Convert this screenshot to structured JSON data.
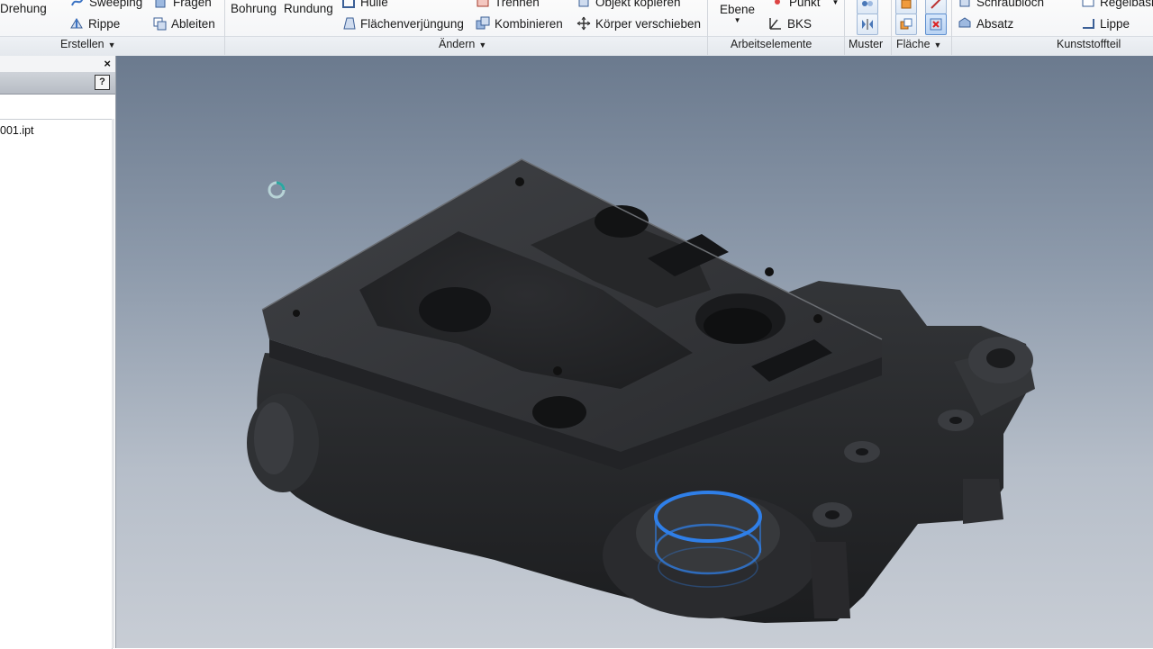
{
  "ribbon": {
    "erstellen": {
      "items": [
        "Drehung",
        "Sweeping",
        "Fragen",
        "Rippe",
        "Ableiten"
      ],
      "group_label": "Erstellen"
    },
    "aendern": {
      "items": [
        "Bohrung",
        "Rundung",
        "Hülle",
        "Flächenverjüngung",
        "Trennen",
        "Kombinieren",
        "Objekt kopieren",
        "Körper verschieben"
      ],
      "group_label": "Ändern"
    },
    "arbeitselemente": {
      "items": [
        "Ebene",
        "Punkt",
        "BKS"
      ],
      "group_label": "Arbeitselemente"
    },
    "muster": {
      "group_label": "Muster"
    },
    "flaeche": {
      "group_label": "Fläche"
    },
    "kunststoffteil": {
      "items": [
        "Schraubloch",
        "Absatz",
        "Regelbasis",
        "Lippe"
      ],
      "group_label": "Kunststoffteil"
    }
  },
  "browser": {
    "close_glyph": "×",
    "help_glyph": "?",
    "file_name": "001.ipt"
  },
  "colors": {
    "selection": "#2f7fe8",
    "part": "#2b2c2f",
    "accent": "#2d62b8"
  }
}
